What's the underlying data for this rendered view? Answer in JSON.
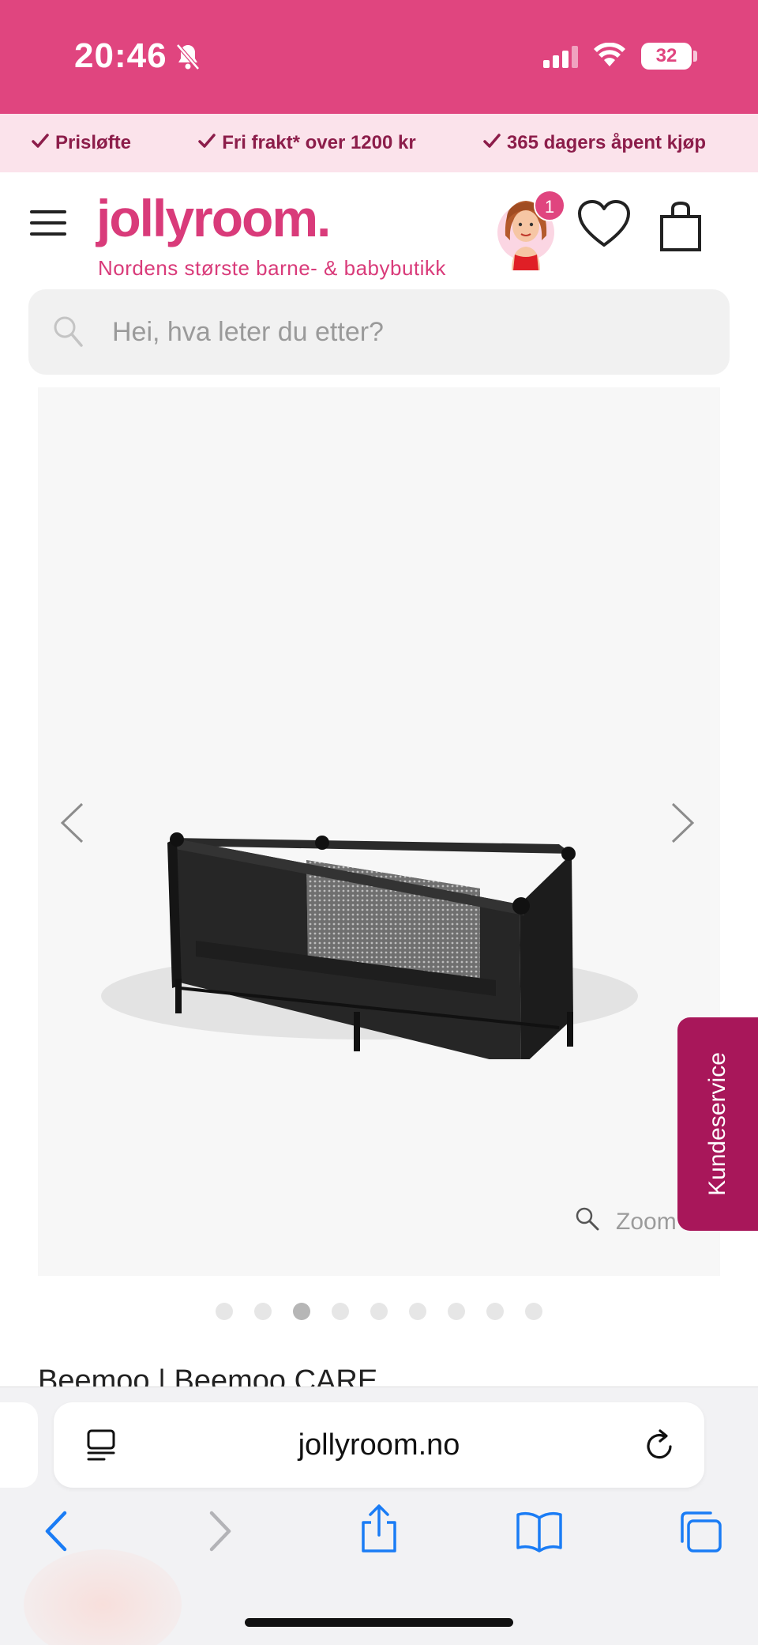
{
  "status_bar": {
    "time": "20:46",
    "battery": "32"
  },
  "usp_bar": {
    "items": [
      "Prisløfte",
      "Fri frakt* over 1200 kr",
      "365 dagers åpent kjøp"
    ]
  },
  "header": {
    "logo": "jollyroom.",
    "tagline": "Nordens største barne- & babybutikk",
    "profile_badge": "1"
  },
  "search": {
    "placeholder": "Hei, hva leter du etter?"
  },
  "gallery": {
    "zoom_label": "Zoom",
    "dot_count": 9,
    "active_index": 2
  },
  "kundeservice": {
    "label": "Kundeservice"
  },
  "product": {
    "title": "Beemoo | Beemoo CARE"
  },
  "browser": {
    "url": "jollyroom.no"
  },
  "colors": {
    "brand_pink": "#e0457f",
    "usp_bg": "#fbe3eb",
    "usp_text": "#8c1d4a",
    "kundeservice_bg": "#a8175a",
    "ios_blue": "#1a7cf5"
  }
}
